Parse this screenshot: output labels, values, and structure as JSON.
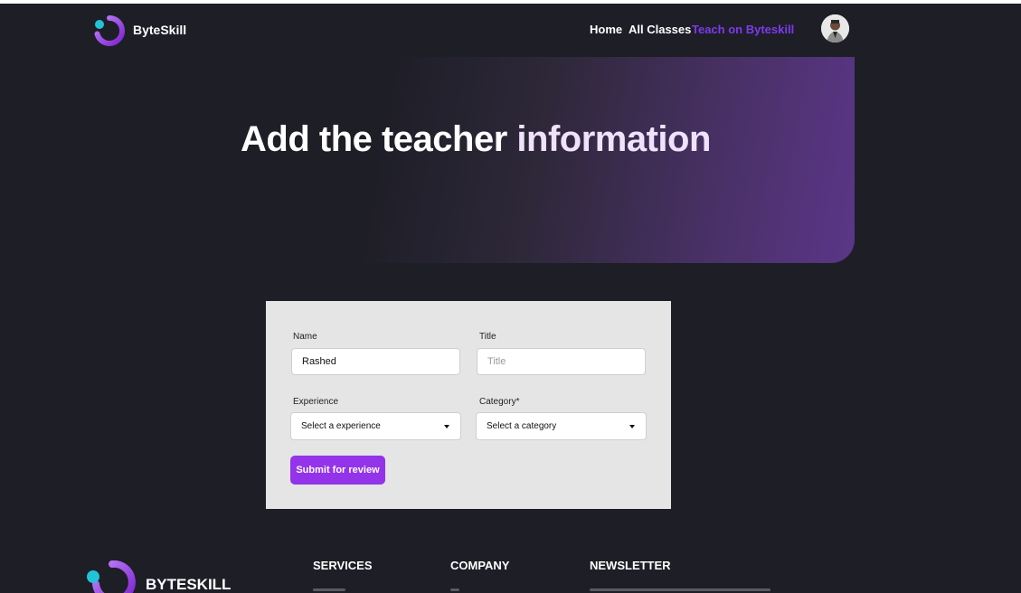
{
  "navbar": {
    "brand": "ByteSkill",
    "links": [
      {
        "label": "Home"
      },
      {
        "label": "All Classes"
      },
      {
        "label": "Teach on Byteskill"
      }
    ]
  },
  "hero": {
    "title_main": "Add the teacher ",
    "title_accent": "information"
  },
  "form": {
    "name_label": "Name",
    "name_value": "Rashed",
    "title_label": "Title",
    "title_placeholder": "Title",
    "experience_label": "Experience",
    "experience_selected": "Select a experience",
    "category_label": "Category*",
    "category_selected": "Select a category",
    "submit_label": "Submit for review"
  },
  "footer": {
    "brand": "BYTESKILL",
    "columns": [
      {
        "heading": "SERVICES"
      },
      {
        "heading": "COMPANY"
      },
      {
        "heading": "NEWSLETTER"
      }
    ]
  },
  "colors": {
    "background": "#1e1e27",
    "accent": "#9333ea",
    "active_link": "#7c3aed",
    "logo_dot": "#22c3d8"
  }
}
